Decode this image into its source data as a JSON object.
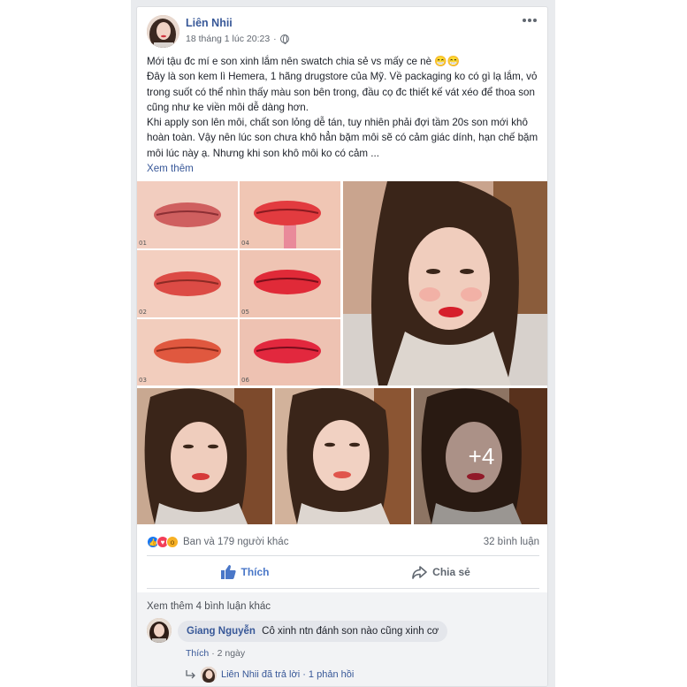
{
  "post": {
    "author": "Liên Nhii",
    "timestamp": "18 tháng 1 lúc 20:23",
    "separator": "·",
    "privacy_icon": "globe-icon",
    "text_lines": [
      "Mới tậu đc mí e son xinh lắm nên swatch chia sẻ vs mấy ce nè 😁😁",
      "Đây là son kem lì Hemera, 1 hãng drugstore của Mỹ. Về packaging ko có gì lạ lắm, vỏ trong suốt có thể nhìn thấy màu son bên trong, đầu cọ đc thiết kế vát xéo để thoa son cũng như ke viền môi dễ dàng hơn.",
      "Khi apply son lên môi, chất son lỏng dễ tán, tuy nhiên phải đợi tầm 20s son mới khô hoàn toàn. Vậy nên lúc son chưa khô hẳn bặm môi sẽ có cảm giác dính, hạn chế bặm môi lúc này ạ. Nhưng khi son khô môi ko có cảm ..."
    ],
    "see_more": "Xem thêm"
  },
  "photos": {
    "extra_count": "+4",
    "swatch_labels": [
      "01",
      "04",
      "02",
      "05",
      "03",
      "06"
    ]
  },
  "reactions": {
    "summary": "Ban và 179 người khác",
    "comment_count": "32 bình luận"
  },
  "actions": {
    "like": "Thích",
    "share": "Chia sẻ"
  },
  "comments": {
    "see_more": "Xem thêm 4 bình luận khác",
    "items": [
      {
        "author": "Giang Nguyễn",
        "text": "Cô xinh ntn đánh son nào cũng xinh cơ",
        "like_label": "Thích",
        "separator": "·",
        "time": "2 ngày"
      }
    ],
    "reply_summary": "Liên Nhii đã trả lời · 1 phản hồi"
  },
  "colors": {
    "link": "#385898",
    "like_active": "#4a77c8",
    "background": "#e9ebee"
  }
}
